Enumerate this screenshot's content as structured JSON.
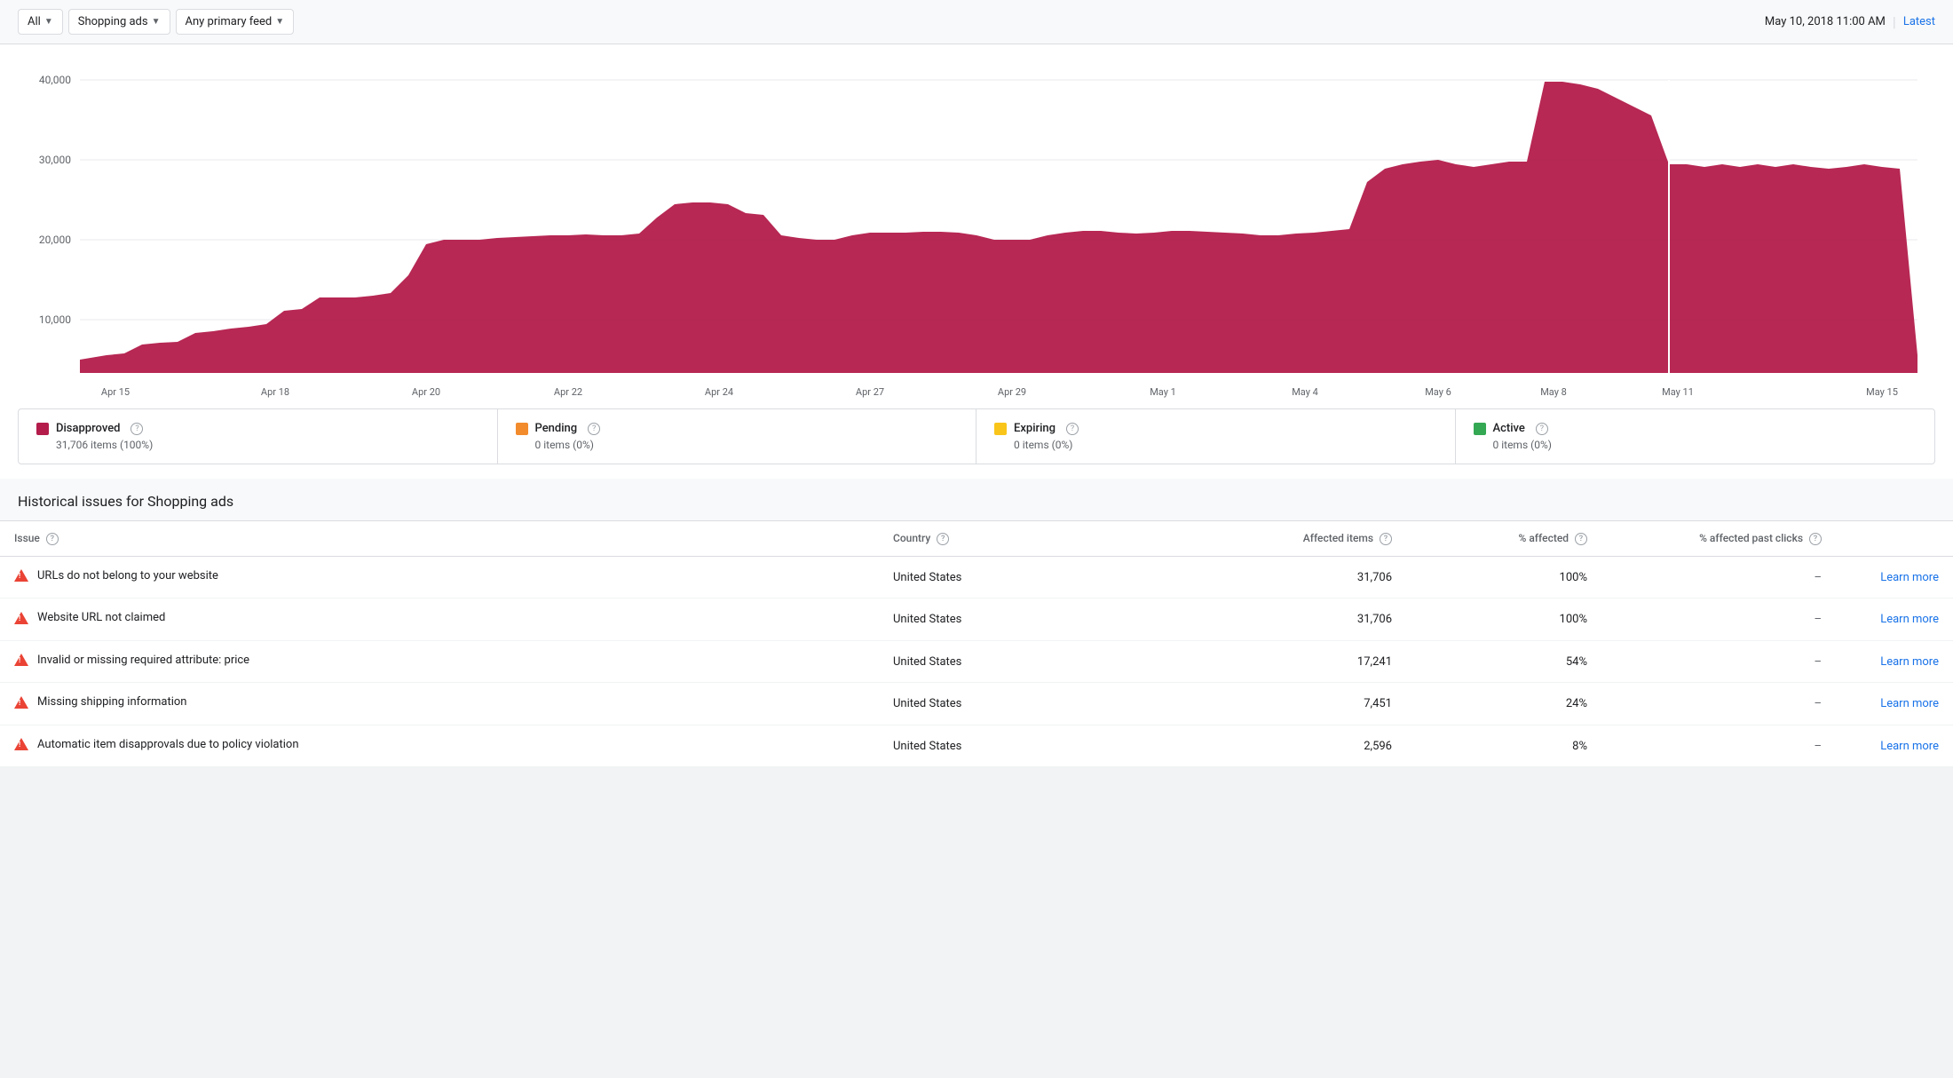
{
  "filterBar": {
    "dropdown1": {
      "label": "All",
      "chevron": "▼"
    },
    "dropdown2": {
      "label": "Shopping ads",
      "chevron": "▼"
    },
    "dropdown3": {
      "label": "Any primary feed",
      "chevron": "▼"
    },
    "date": "May 10, 2018  11:00 AM",
    "separator": "|",
    "latestLabel": "Latest"
  },
  "chart": {
    "yLabels": [
      "40,000",
      "30,000",
      "20,000",
      "10,000"
    ],
    "xLabels": [
      "Apr 15",
      "Apr 18",
      "Apr 20",
      "Apr 22",
      "Apr 24",
      "Apr 27",
      "Apr 29",
      "May 1",
      "May 4",
      "May 6",
      "May 8",
      "May 11",
      "May 15"
    ],
    "color": "#b31c4b"
  },
  "legend": [
    {
      "id": "disapproved",
      "label": "Disapproved",
      "color": "#b31c4b",
      "value": "31,706 items (100%)"
    },
    {
      "id": "pending",
      "label": "Pending",
      "color": "#f28b2c",
      "value": "0 items (0%)"
    },
    {
      "id": "expiring",
      "label": "Expiring",
      "color": "#f9c51a",
      "value": "0 items (0%)"
    },
    {
      "id": "active",
      "label": "Active",
      "color": "#34a853",
      "value": "0 items (0%)"
    }
  ],
  "issuesSection": {
    "title": "Historical issues for Shopping ads",
    "columns": {
      "issue": "Issue",
      "country": "Country",
      "affectedItems": "Affected items",
      "pctAffected": "% affected",
      "pctPastClicks": "% affected past clicks",
      "action": ""
    },
    "rows": [
      {
        "issue": "URLs do not belong to your website",
        "country": "United States",
        "affectedItems": "31,706",
        "pctAffected": "100%",
        "pctPastClicks": "–",
        "learnMore": "Learn more"
      },
      {
        "issue": "Website URL not claimed",
        "country": "United States",
        "affectedItems": "31,706",
        "pctAffected": "100%",
        "pctPastClicks": "–",
        "learnMore": "Learn more"
      },
      {
        "issue": "Invalid or missing required attribute: price",
        "country": "United States",
        "affectedItems": "17,241",
        "pctAffected": "54%",
        "pctPastClicks": "–",
        "learnMore": "Learn more"
      },
      {
        "issue": "Missing shipping information",
        "country": "United States",
        "affectedItems": "7,451",
        "pctAffected": "24%",
        "pctPastClicks": "–",
        "learnMore": "Learn more"
      },
      {
        "issue": "Automatic item disapprovals due to policy violation",
        "country": "United States",
        "affectedItems": "2,596",
        "pctAffected": "8%",
        "pctPastClicks": "–",
        "learnMore": "Learn more"
      }
    ]
  }
}
